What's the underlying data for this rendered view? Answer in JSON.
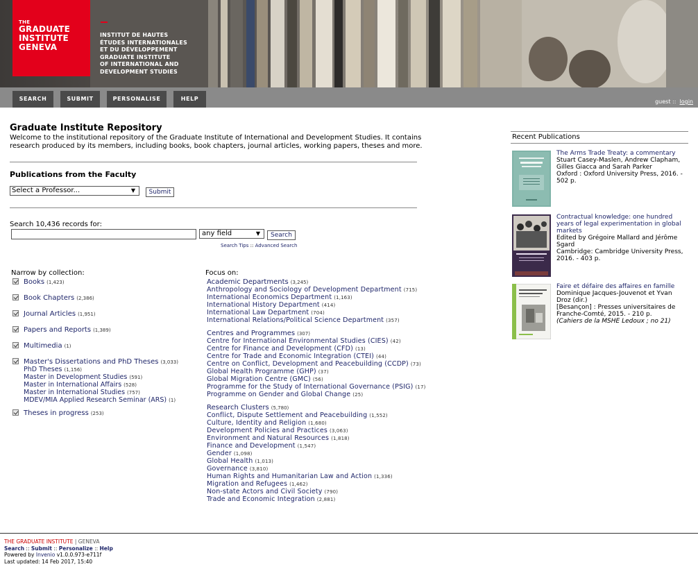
{
  "header": {
    "logo_the": "THE",
    "logo_line1": "GRADUATE",
    "logo_line2": "INSTITUTE",
    "logo_line3": "GENEVA",
    "logo_text": [
      "INSTITUT DE HAUTES",
      "ÉTUDES INTERNATIONALES",
      "ET DU DÉVELOPPEMENT",
      "GRADUATE INSTITUTE",
      "OF INTERNATIONAL AND",
      "DEVELOPMENT STUDIES"
    ],
    "brand_color": "#e3001b"
  },
  "nav": {
    "search": "SEARCH",
    "submit": "SUBMIT",
    "personalise": "PERSONALISE",
    "help": "HELP",
    "user": "guest",
    "separator": "::",
    "login": "login"
  },
  "main": {
    "title": "Graduate Institute Repository",
    "intro": "Welcome to the institutional repository of the Graduate Institute of International and Development Studies. It contains research produced by its members, including books, book chapters, journal articles, working papers, theses and more.",
    "faculty_heading": "Publications from the Faculty",
    "professor_select": "Select a Professor...",
    "faculty_submit": "Submit"
  },
  "search": {
    "label": "Search 10,436 records for:",
    "input_value": "",
    "field_select": "any field",
    "button": "Search",
    "tips": "Search Tips",
    "sep": "::",
    "advanced": "Advanced Search"
  },
  "collections": {
    "label": "Narrow by collection:",
    "items": [
      {
        "label": "Books",
        "count": "(1,423)"
      },
      {
        "label": "Book Chapters",
        "count": "(2,386)"
      },
      {
        "label": "Journal Articles",
        "count": "(1,951)"
      },
      {
        "label": "Papers and Reports",
        "count": "(1,389)"
      },
      {
        "label": "Multimedia",
        "count": "(1)"
      },
      {
        "label": "Master's Dissertations and PhD Theses",
        "count": "(3,033)"
      },
      {
        "label": "Theses in progress",
        "count": "(253)"
      }
    ],
    "subitems": [
      {
        "label": "PhD Theses",
        "count": "(1,156)"
      },
      {
        "label": "Master in Development Studies",
        "count": "(591)"
      },
      {
        "label": "Master in International Affairs",
        "count": "(528)"
      },
      {
        "label": "Master in International Studies",
        "count": "(757)"
      },
      {
        "label": "MDEV/MIA Applied Research Seminar (ARS)",
        "count": "(1)"
      }
    ]
  },
  "focus": {
    "label": "Focus on:",
    "groups": [
      {
        "head": "Academic Departments",
        "count": "(3,245)",
        "items": [
          {
            "label": "Anthropology and Sociology of Development Department",
            "count": "(715)"
          },
          {
            "label": "International Economics Department",
            "count": "(1,163)"
          },
          {
            "label": "International History Department",
            "count": "(414)"
          },
          {
            "label": "International Law Department",
            "count": "(704)"
          },
          {
            "label": "International Relations/Political Science Department",
            "count": "(357)"
          }
        ]
      },
      {
        "head": "Centres and Programmes",
        "count": "(307)",
        "items": [
          {
            "label": "Centre for International Environmental Studies (CIES)",
            "count": "(42)"
          },
          {
            "label": "Centre for Finance and Development (CFD)",
            "count": "(13)"
          },
          {
            "label": "Centre for Trade and Economic Integration (CTEI)",
            "count": "(44)"
          },
          {
            "label": "Centre on Conflict, Development and Peacebuilding (CCDP)",
            "count": "(73)"
          },
          {
            "label": "Global Health Programme (GHP)",
            "count": "(37)"
          },
          {
            "label": "Global Migration Centre (GMC)",
            "count": "(56)"
          },
          {
            "label": "Programme for the Study of International Governance (PSIG)",
            "count": "(17)"
          },
          {
            "label": "Programme on Gender and Global Change",
            "count": "(25)"
          }
        ]
      },
      {
        "head": "Research Clusters",
        "count": "(5,780)",
        "items": [
          {
            "label": "Conflict, Dispute Settlement and Peacebuilding",
            "count": "(1,552)"
          },
          {
            "label": "Culture, Identity and Religion",
            "count": "(1,680)"
          },
          {
            "label": "Development Policies and Practices",
            "count": "(3,063)"
          },
          {
            "label": "Environment and Natural Resources",
            "count": "(1,818)"
          },
          {
            "label": "Finance and Development",
            "count": "(1,547)"
          },
          {
            "label": "Gender",
            "count": "(1,098)"
          },
          {
            "label": "Global Health",
            "count": "(1,013)"
          },
          {
            "label": "Governance",
            "count": "(3,810)"
          },
          {
            "label": "Human Rights and Humanitarian Law and Action",
            "count": "(1,336)"
          },
          {
            "label": "Migration and Refugees",
            "count": "(1,462)"
          },
          {
            "label": "Non-state Actors and Civil Society",
            "count": "(790)"
          },
          {
            "label": "Trade and Economic Integration",
            "count": "(2,881)"
          }
        ]
      }
    ]
  },
  "recent": {
    "title": "Recent Publications",
    "pubs": [
      {
        "title": "The Arms Trade Treaty: a commentary",
        "authors": "Stuart Casey-Maslen, Andrew Clapham, Gilles Giacca and Sarah Parker",
        "imprint": "Oxford : Oxford University Press, 2016. - 502 p.",
        "series": "",
        "cover_title": "THE ARMS TRADE TREATY"
      },
      {
        "title": "Contractual knowledge: one hundred years of legal experimentation in global markets",
        "authors": "Edited by Grégoire Mallard and Jérôme Sgard",
        "imprint": "Cambridge: Cambridge University Press, 2016. - 403 p.",
        "series": "",
        "cover_title": "Contractual Knowledge"
      },
      {
        "title": "Faire et défaire des affaires en famille",
        "authors": "Dominique Jacques-Jouvenot et Yvan Droz (dir.)",
        "imprint": "[Besançon] : Presses universitaires de Franche-Comté, 2015. - 210 p.",
        "series": "(Cahiers de la MSHE Ledoux ; no 21)",
        "cover_title": "Faire et défaire des affaires en famille"
      }
    ]
  },
  "footer": {
    "brand": "THE GRADUATE INSTITUTE",
    "pipe": " | ",
    "geneva": "GENEVA",
    "links": [
      "Search",
      "Submit",
      "Personalize",
      "Help"
    ],
    "powered_prefix": "Powered by",
    "powered_link": "Invenio",
    "version": "v1.0.0.973-e711f",
    "updated": "Last updated: 14 Feb 2017, 15:40"
  }
}
